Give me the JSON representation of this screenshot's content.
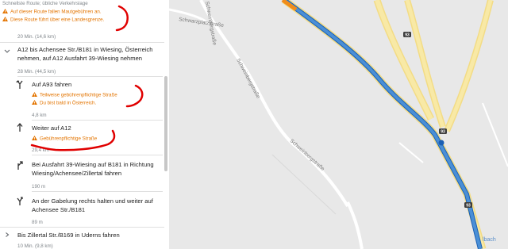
{
  "summary": {
    "route_type": "Schnellste Route; übliche Verkehrslage",
    "warning_toll": "Auf dieser Route fallen Mautgebühren an.",
    "warning_border": "Diese Route führt über eine Landesgrenze."
  },
  "group1_distance": "20 Min.  (14,6 km)",
  "group2": {
    "title_line1": "A12 bis Achensee Str./B181 in Wiesing, Österreich",
    "title_line2": "nehmen, auf A12 Ausfahrt 39-Wiesing nehmen",
    "time_distance": "28 Min.  (44,5 km)"
  },
  "steps": [
    {
      "instruction_line1": "Auf A93 fahren",
      "warnings": [
        "Teilweise gebührenpflichtige Straße",
        "Du bist bald in Österreich."
      ],
      "distance": "4,8 km"
    },
    {
      "instruction_line1": "Weiter auf A12",
      "warnings": [
        "Gebührenpflichtige Straße"
      ],
      "distance": "29,4 km"
    },
    {
      "instruction_line1": "Bei Ausfahrt 39-Wiesing auf B181 in Richtung",
      "instruction_line2": "Wiesing/Achensee/Zillertal fahren",
      "distance": "190 m"
    },
    {
      "instruction_line1": "An der Gabelung rechts halten und weiter auf",
      "instruction_line2": "Achensee Str./B181",
      "distance": "89 m"
    }
  ],
  "group3": {
    "title": "Bis Zillertal Str./B169 in Uderns fahren",
    "time_distance": "10 Min.  (9,8 km)"
  },
  "map": {
    "street_labels": [
      "Schwarzplatzstraße",
      "Schweinbergstraße",
      "Schweinbergstraße",
      "Schweinbergstraße"
    ],
    "shields": [
      "93",
      "93",
      "93"
    ],
    "place_label": "lbach",
    "route_color": "#4a8fd6",
    "highway_color": "#f6e497"
  },
  "colors": {
    "warning": "#e37400",
    "annotation": "#e00000"
  }
}
